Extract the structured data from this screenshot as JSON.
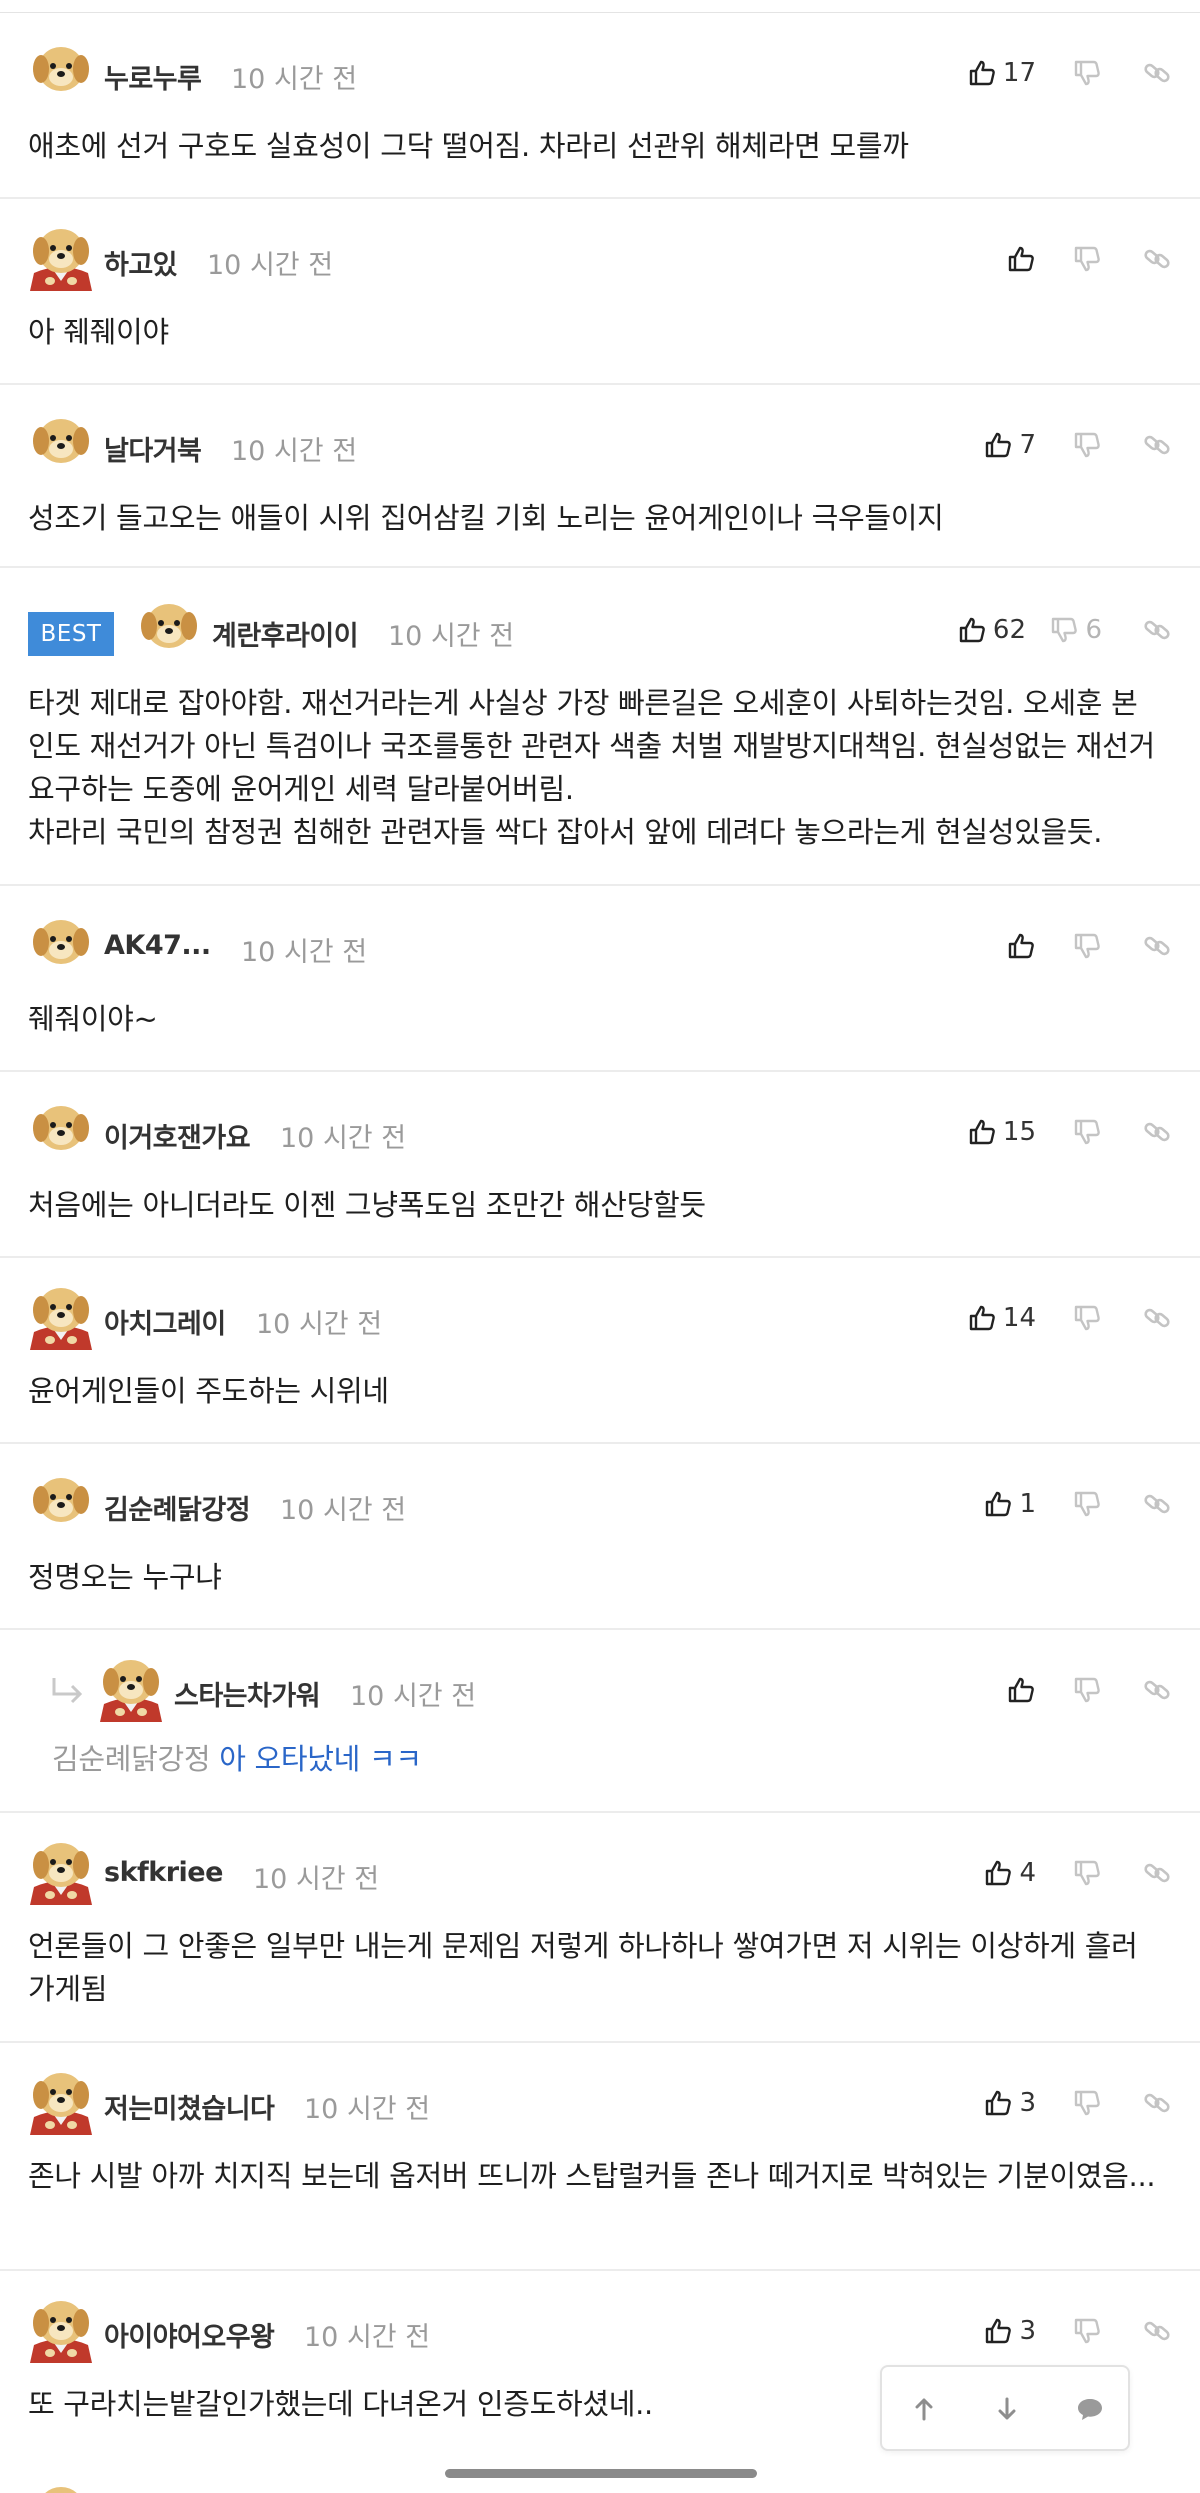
{
  "comments": [
    {
      "nick": "누로누루",
      "time": "10 시간 전",
      "text": "애초에 선거 구호도 실효성이 그닥 떨어짐. 차라리 선관위 해체라면 모를까",
      "likes": "17",
      "dislikes": "",
      "cape": false
    },
    {
      "nick": "하고있",
      "time": "10 시간 전",
      "text": "아 줴줴이야",
      "likes": "",
      "dislikes": "",
      "cape": true
    },
    {
      "nick": "날다거북",
      "time": "10 시간 전",
      "text": "성조기 들고오는 애들이 시위 집어삼킬 기회 노리는 윤어게인이나 극우들이지",
      "likes": "7",
      "dislikes": "",
      "cape": false
    },
    {
      "nick": "계란후라이이",
      "time": "10 시간 전",
      "badge": "BEST",
      "text": "타겟 제대로 잡아야함. 재선거라는게 사실상 가장 빠른길은 오세훈이 사퇴하는것임. 오세훈 본인도 재선거가 아닌 특검이나 국조를통한 관련자 색출 처벌 재발방지대책임. 현실성없는 재선거 요구하는 도중에 윤어게인 세력 달라붙어버림.",
      "text2": "차라리 국민의 참정권 침해한 관련자들 싹다 잡아서 앞에 데려다 놓으라는게 현실성있을듯.",
      "likes": "62",
      "dislikes": "6",
      "cape": false
    },
    {
      "nick": "AK47...",
      "time": "10 시간 전",
      "text": "줴줘이야~",
      "likes": "",
      "dislikes": "",
      "cape": false
    },
    {
      "nick": "이거호잰가요",
      "time": "10 시간 전",
      "text": "처음에는 아니더라도 이젠 그냥폭도임 조만간 해산당할듯",
      "likes": "15",
      "dislikes": "",
      "cape": false
    },
    {
      "nick": "아치그레이",
      "time": "10 시간 전",
      "text": "윤어게인들이 주도하는 시위네",
      "likes": "14",
      "dislikes": "",
      "cape": true
    },
    {
      "nick": "김순례닭강정",
      "time": "10 시간 전",
      "text": "정명오는 누구냐",
      "likes": "1",
      "dislikes": "",
      "cape": false
    },
    {
      "nick": "스타는차가워",
      "time": "10 시간 전",
      "mention": "김순례닭강정",
      "text": "아 오타났네 ㅋㅋ",
      "likes": "",
      "dislikes": "",
      "cape": true,
      "reply": true
    },
    {
      "nick": "skfkriee",
      "time": "10 시간 전",
      "text": "언론들이 그 안좋은 일부만 내는게 문제임 저렇게 하나하나 쌓여가면 저 시위는 이상하게 흘러가게됨",
      "likes": "4",
      "dislikes": "",
      "cape": true
    },
    {
      "nick": "저는미쳤습니다",
      "time": "10 시간 전",
      "text": "존나 시발 아까 치지직 보는데 옵저버 뜨니까 스탑럴커들 존나 떼거지로 박혀있는 기분이였음...",
      "likes": "3",
      "dislikes": "",
      "cape": true
    },
    {
      "nick": "아이야어오우왕",
      "time": "10 시간 전",
      "text": "또 구라치는밭갈인가했는데 다녀온거 인증도하셨네..",
      "likes": "3",
      "dislikes": "",
      "cape": true
    }
  ],
  "icons": {
    "like": "thumbs-up-icon",
    "dislike": "thumbs-down-icon",
    "share": "link-icon",
    "reply": "reply-arrow-icon",
    "up": "arrow-up-icon",
    "down": "arrow-down-icon",
    "chat": "chat-bubble-icon"
  },
  "colors": {
    "best_badge": "#3f8bd9",
    "reply_text": "#2a66c8",
    "muted": "#9a9a9a"
  }
}
